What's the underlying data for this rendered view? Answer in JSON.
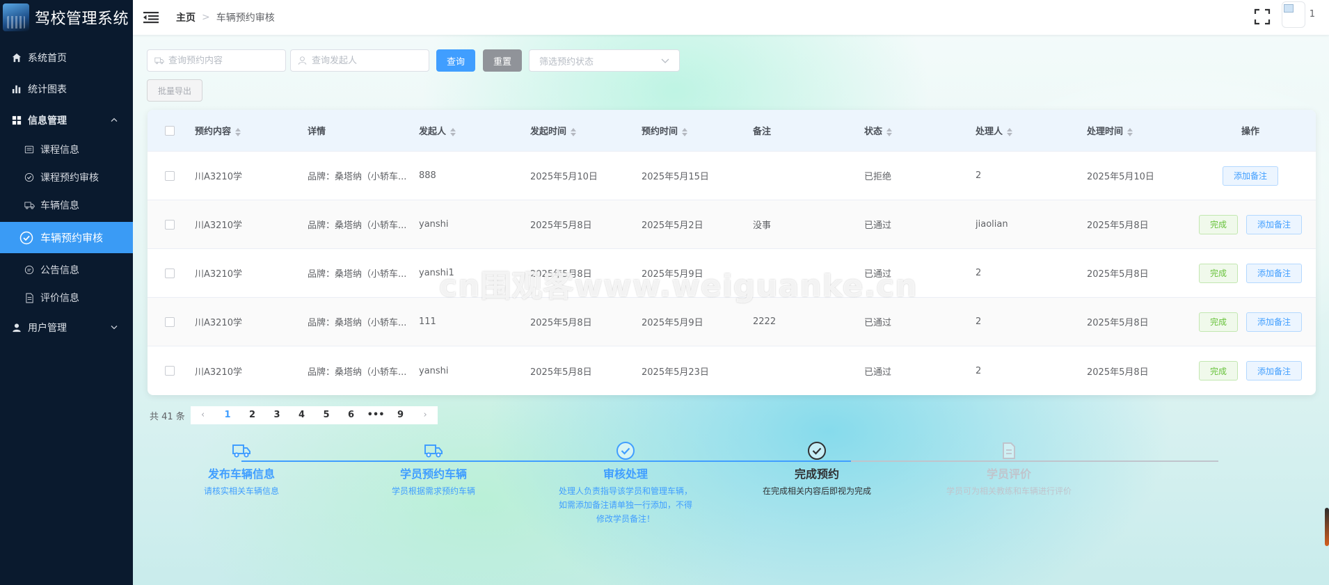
{
  "app": {
    "title": "驾校管理系统"
  },
  "sidebar": {
    "items": [
      {
        "label": "系统首页",
        "icon": "home-icon"
      },
      {
        "label": "统计图表",
        "icon": "bar-chart-icon"
      },
      {
        "label": "信息管理",
        "icon": "grid-icon",
        "expanded": true,
        "children": [
          {
            "label": "课程信息",
            "icon": "calendar-icon"
          },
          {
            "label": "课程预约审核",
            "icon": "check-circle-icon"
          },
          {
            "label": "车辆信息",
            "icon": "truck-icon"
          },
          {
            "label": "车辆预约审核",
            "icon": "check-circle-icon",
            "active": true
          },
          {
            "label": "公告信息",
            "icon": "chat-icon"
          },
          {
            "label": "评价信息",
            "icon": "document-icon"
          }
        ]
      },
      {
        "label": "用户管理",
        "icon": "user-icon"
      }
    ]
  },
  "header": {
    "breadcrumb_home": "主页",
    "breadcrumb_current": "车辆预约审核",
    "user_label": "1"
  },
  "toolbar": {
    "search_content_placeholder": "查询预约内容",
    "search_initiator_placeholder": "查询发起人",
    "query_label": "查询",
    "reset_label": "重置",
    "status_filter_placeholder": "筛选预约状态",
    "export_label": "批量导出"
  },
  "table": {
    "columns": [
      "预约内容",
      "详情",
      "发起人",
      "发起时间",
      "预约时间",
      "备注",
      "状态",
      "处理人",
      "处理时间",
      "操作"
    ],
    "rows": [
      {
        "content": "川A3210学",
        "detail": "品牌：桑塔纳（小轿车...",
        "initiator": "888",
        "initiated": "2025年5月10日",
        "booked": "2025年5月15日",
        "note": "",
        "status": "已拒绝",
        "handler": "2",
        "handled": "2025年5月10日",
        "show_done": false
      },
      {
        "content": "川A3210学",
        "detail": "品牌：桑塔纳（小轿车...",
        "initiator": "yanshi",
        "initiated": "2025年5月8日",
        "booked": "2025年5月2日",
        "note": "没事",
        "status": "已通过",
        "handler": "jiaolian",
        "handled": "2025年5月8日",
        "show_done": true
      },
      {
        "content": "川A3210学",
        "detail": "品牌：桑塔纳（小轿车...",
        "initiator": "yanshi1",
        "initiated": "2025年5月8日",
        "booked": "2025年5月9日",
        "note": "",
        "status": "已通过",
        "handler": "2",
        "handled": "2025年5月8日",
        "show_done": true
      },
      {
        "content": "川A3210学",
        "detail": "品牌：桑塔纳（小轿车...",
        "initiator": "111",
        "initiated": "2025年5月8日",
        "booked": "2025年5月9日",
        "note": "2222",
        "status": "已通过",
        "handler": "2",
        "handled": "2025年5月8日",
        "show_done": true
      },
      {
        "content": "川A3210学",
        "detail": "品牌：桑塔纳（小轿车...",
        "initiator": "yanshi",
        "initiated": "2025年5月8日",
        "booked": "2025年5月23日",
        "note": "",
        "status": "已通过",
        "handler": "2",
        "handled": "2025年5月8日",
        "show_done": true
      }
    ],
    "done_label": "完成",
    "note_label": "添加备注"
  },
  "pagination": {
    "total_text": "共 41 条",
    "pages": [
      "1",
      "2",
      "3",
      "4",
      "5",
      "6",
      "•••",
      "9"
    ],
    "current": "1"
  },
  "steps": [
    {
      "title": "发布车辆信息",
      "desc": "请核实相关车辆信息",
      "icon": "truck-icon",
      "state": "done"
    },
    {
      "title": "学员预约车辆",
      "desc": "学员根据需求预约车辆",
      "icon": "truck-icon",
      "state": "done"
    },
    {
      "title": "审核处理",
      "desc": "处理人负责指导该学员和管理车辆，如需添加备注请单独一行添加，不得修改学员备注！",
      "icon": "check-circle-icon",
      "state": "done"
    },
    {
      "title": "完成预约",
      "desc": "在完成相关内容后即视为完成",
      "icon": "check-circle-icon",
      "state": "process"
    },
    {
      "title": "学员评价",
      "desc": "学员可为相关教练和车辆进行评价",
      "icon": "document-icon",
      "state": "wait"
    }
  ],
  "watermark": "cn围观客www.weiguanke.cn",
  "colors": {
    "primary": "#409eff",
    "sidebar_bg": "#0a1a2e",
    "active_menu": "#3a9bf5",
    "success": "#67c23a"
  }
}
